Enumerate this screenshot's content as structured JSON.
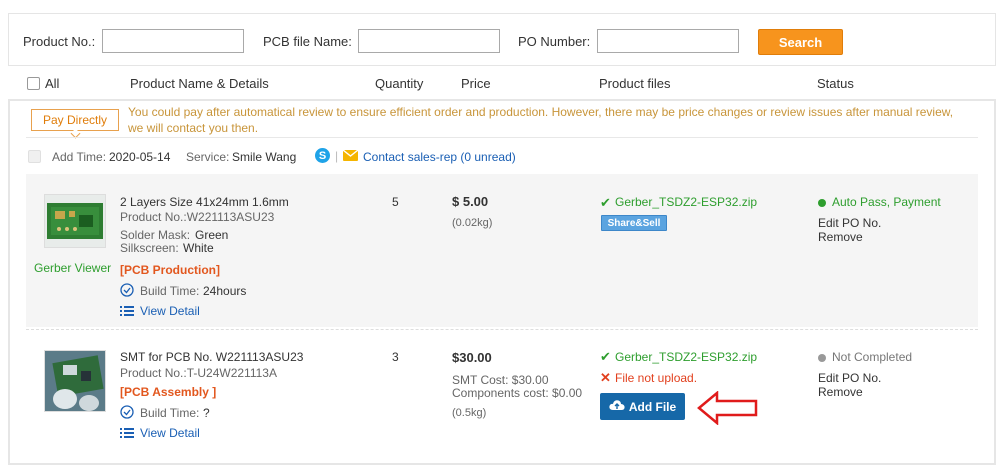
{
  "search": {
    "product_no_label": "Product No.:",
    "pcb_file_label": "PCB file Name:",
    "po_number_label": "PO Number:",
    "product_no_value": "",
    "pcb_file_value": "",
    "po_number_value": "",
    "search_label": "Search",
    "accent_color": "#f7941d"
  },
  "table_header": {
    "all": "All",
    "product": "Product Name & Details",
    "quantity": "Quantity",
    "price": "Price",
    "files": "Product files",
    "status": "Status"
  },
  "order": {
    "pay_tag": "Pay Directly",
    "notice": "You could pay after automatical review to ensure efficient order and production. However, there may be price changes or review issues after manual review, we will contact you then.",
    "add_time_label": "Add Time:",
    "add_time": "2020-05-14",
    "service_label": "Service:",
    "service_name": "Smile Wang",
    "contact": "Contact sales-rep (0 unread)"
  },
  "items": [
    {
      "title": "2 Layers Size 41x24mm 1.6mm",
      "product_no": "Product No.:W221113ASU23",
      "solder_mask_label": "Solder Mask:",
      "solder_mask": "Green",
      "silkscreen_label": "Silkscreen:",
      "silkscreen": "White",
      "tag": "[PCB Production]",
      "build_time_label": "Build Time:",
      "build_time": "24hours",
      "view_detail": "View Detail",
      "thumb_caption": "Gerber Viewer",
      "quantity": "5",
      "price": "$ 5.00",
      "weight": "(0.02kg)",
      "file": "Gerber_TSDZ2-ESP32.zip",
      "share_label": "Share&Sell",
      "status": "Auto Pass, Payment",
      "status_color": "#2e9e2e",
      "edit_po": "Edit PO No.",
      "remove": "Remove"
    },
    {
      "title": "SMT for PCB No. W221113ASU23",
      "product_no": "Product No.:T-U24W221113A",
      "tag": "[PCB Assembly ]",
      "build_time_label": "Build Time:",
      "build_time": "?",
      "view_detail": "View Detail",
      "quantity": "3",
      "price": "$30.00",
      "smt_cost": "SMT Cost: $30.00",
      "components_cost": "Components cost: $0.00",
      "weight": "(0.5kg)",
      "file": "Gerber_TSDZ2-ESP32.zip",
      "file_missing": "File not upload.",
      "add_file_label": "Add File",
      "status": "Not Completed",
      "status_color": "#999999",
      "edit_po": "Edit PO No.",
      "remove": "Remove"
    }
  ]
}
